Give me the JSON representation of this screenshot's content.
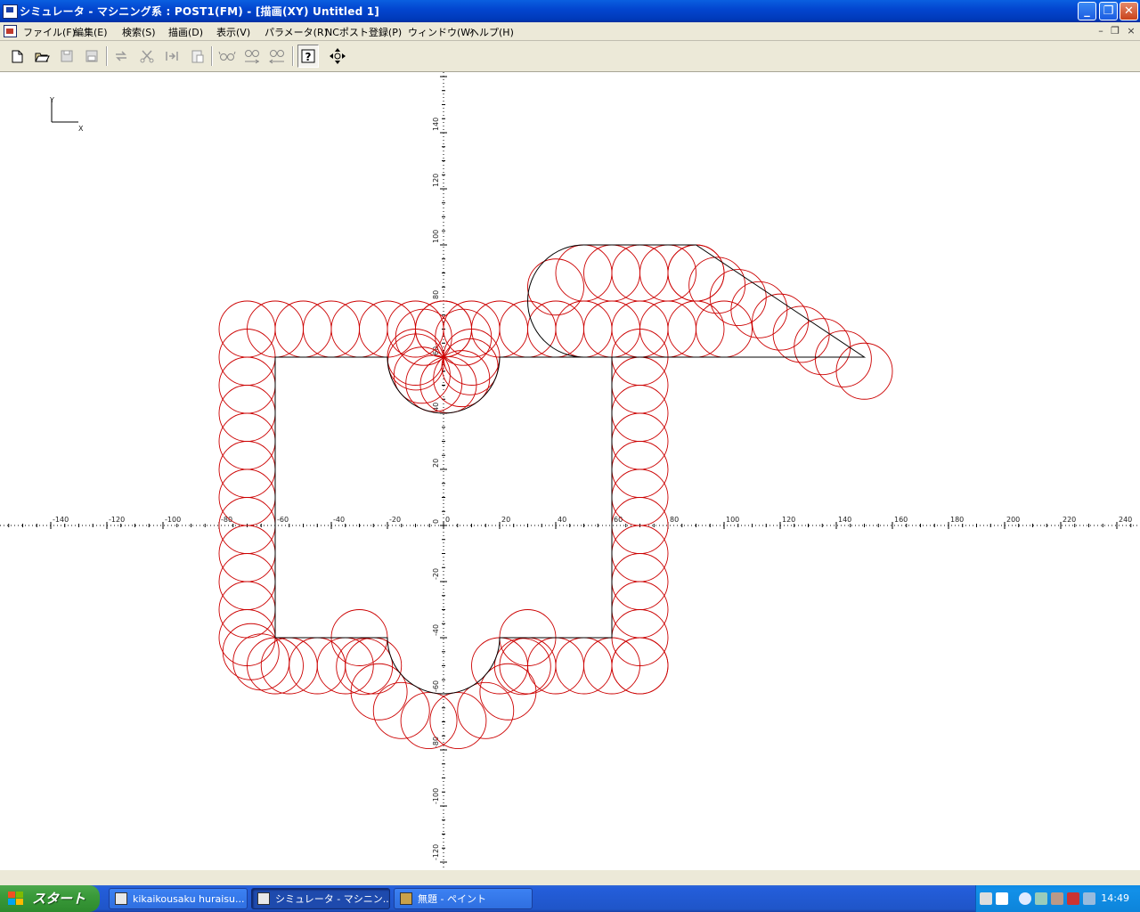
{
  "window": {
    "title": "シミュレータ - マシニング系 : POST1(FM) - [描画(XY) Untitled 1]",
    "buttons": {
      "minimize": "_",
      "restore": "❐",
      "close": "✕"
    }
  },
  "menu": {
    "items": [
      "ファイル(F)",
      "編集(E)",
      "検索(S)",
      "描画(D)",
      "表示(V)",
      "パラメータ(R)",
      "NCポスト登録(P)",
      "ウィンドウ(W)",
      "ヘルプ(H)"
    ],
    "mdi_buttons": {
      "minimize": "–",
      "restore": "❐",
      "close": "×"
    }
  },
  "toolbar": {
    "buttons": [
      "new-file",
      "open-file",
      "save",
      "save-as",
      "redo",
      "cut",
      "mirror",
      "paste",
      "view-glasses",
      "view-glasses-forward",
      "view-glasses-back",
      "help",
      "move-view"
    ]
  },
  "plot": {
    "axis_labels": {
      "x": "X",
      "y": "Y"
    },
    "x_ticks": [
      "-140",
      "-120",
      "-100",
      "-80",
      "-60",
      "-40",
      "-20",
      "0",
      "20",
      "40",
      "60",
      "80",
      "100",
      "120",
      "140",
      "160",
      "180",
      "200",
      "220",
      "240"
    ],
    "y_ticks": [
      "140",
      "120",
      "100",
      "80",
      "60",
      "40",
      "20",
      "0",
      "-20",
      "-40",
      "-60",
      "-80",
      "-100",
      "-120"
    ],
    "colors": {
      "toolpath": "#cc0000",
      "contour": "#000000",
      "axis": "#000000"
    }
  },
  "taskbar": {
    "start_label": "スタート",
    "tasks": [
      {
        "label": "kikaikousaku huraisu...",
        "active": false
      },
      {
        "label": "シミュレータ - マシニン...",
        "active": true
      },
      {
        "label": "無題 - ペイント",
        "active": false
      }
    ],
    "clock": "14:49"
  }
}
